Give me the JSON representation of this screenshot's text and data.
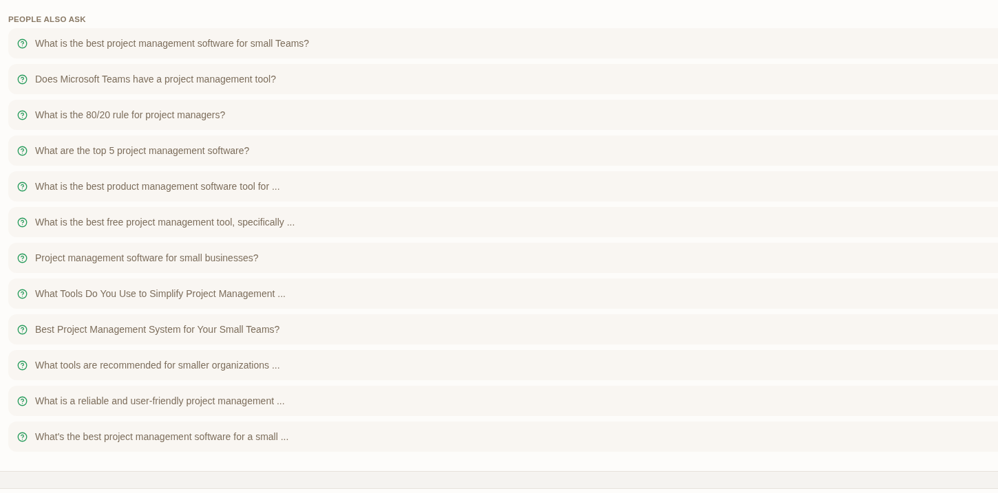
{
  "heading": "PEOPLE ALSO ASK",
  "questions": [
    "What is the best project management software for small Teams?",
    "Does Microsoft Teams have a project management tool?",
    "What is the 80/20 rule for project managers?",
    "What are the top 5 project management software?",
    "What is the best product management software tool for ...",
    "What is the best free project management tool, specifically ...",
    "Project management software for small businesses?",
    "What Tools Do You Use to Simplify Project Management ...",
    "Best Project Management System for Your Small Teams?",
    "What tools are recommended for smaller organizations ...",
    "What is a reliable and user-friendly project management ...",
    "What's the best project management software for a small ..."
  ]
}
